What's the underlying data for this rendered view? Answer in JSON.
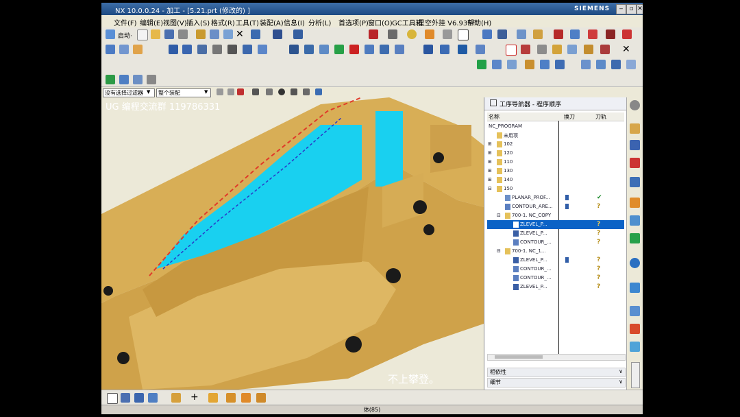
{
  "window": {
    "title": "NX 10.0.0.24 - 加工 - [5.21.prt  (修改的) ]",
    "brand": "SIEMENS",
    "controls": [
      "‒",
      "▫",
      "✕"
    ]
  },
  "menu": [
    "文件(F)",
    "编辑(E)",
    "视图(V)",
    "插入(S)",
    "格式(R)",
    "工具(T)",
    "装配(A)",
    "信息(I)",
    "分析(L)",
    "首选项(P)",
    "窗口(O)",
    "GC工具箱",
    "星空外挂 V6.935F",
    "帮助(H)"
  ],
  "toolbar": {
    "start_label": "启动·"
  },
  "filter": {
    "type_filter": "没有选择过滤器",
    "assembly_scope": "整个装配"
  },
  "viewport": {
    "watermark": "UG 编程交流群 119786331",
    "subtitle": "不上攀登。"
  },
  "navigator": {
    "title": "工序导航器 - 程序顺序",
    "columns": [
      "名称",
      "换刀",
      "刀轨"
    ],
    "rows": [
      {
        "label": "NC_PROGRAM",
        "indent": 0,
        "tool": false,
        "path": ""
      },
      {
        "label": "未用项",
        "indent": 1,
        "tool": false,
        "path": ""
      },
      {
        "label": "102",
        "indent": 1,
        "tool": false,
        "path": ""
      },
      {
        "label": "120",
        "indent": 1,
        "tool": false,
        "path": ""
      },
      {
        "label": "110",
        "indent": 1,
        "tool": false,
        "path": ""
      },
      {
        "label": "130",
        "indent": 1,
        "tool": false,
        "path": ""
      },
      {
        "label": "140",
        "indent": 1,
        "tool": false,
        "path": ""
      },
      {
        "label": "150",
        "indent": 1,
        "tool": false,
        "path": ""
      },
      {
        "label": "PLANAR_PROF...",
        "indent": 2,
        "tool": true,
        "path": "✔"
      },
      {
        "label": "CONTOUR_ARE...",
        "indent": 2,
        "tool": true,
        "path": "?"
      },
      {
        "label": "700-1. NC_COPY",
        "indent": 2,
        "tool": false,
        "path": ""
      },
      {
        "label": "ZLEVEL_P...",
        "indent": 3,
        "tool": false,
        "path": "?",
        "selected": true
      },
      {
        "label": "ZLEVEL_P...",
        "indent": 3,
        "tool": false,
        "path": "?"
      },
      {
        "label": "CONTOUR_...",
        "indent": 3,
        "tool": false,
        "path": "?"
      },
      {
        "label": "700-1. NC_1...",
        "indent": 2,
        "tool": false,
        "path": ""
      },
      {
        "label": "ZLEVEL_P...",
        "indent": 3,
        "tool": true,
        "path": "?"
      },
      {
        "label": "CONTOUR_...",
        "indent": 3,
        "tool": false,
        "path": "?"
      },
      {
        "label": "CONTOUR_...",
        "indent": 3,
        "tool": false,
        "path": "?"
      },
      {
        "label": "ZLEVEL_P...",
        "indent": 3,
        "tool": false,
        "path": "?"
      }
    ],
    "panels": [
      "相依性",
      "细节"
    ]
  },
  "status": "体(85)",
  "colors": {
    "part": "#d9b05a",
    "highlight": "#19d0f0",
    "selection": "#0b62c6"
  }
}
